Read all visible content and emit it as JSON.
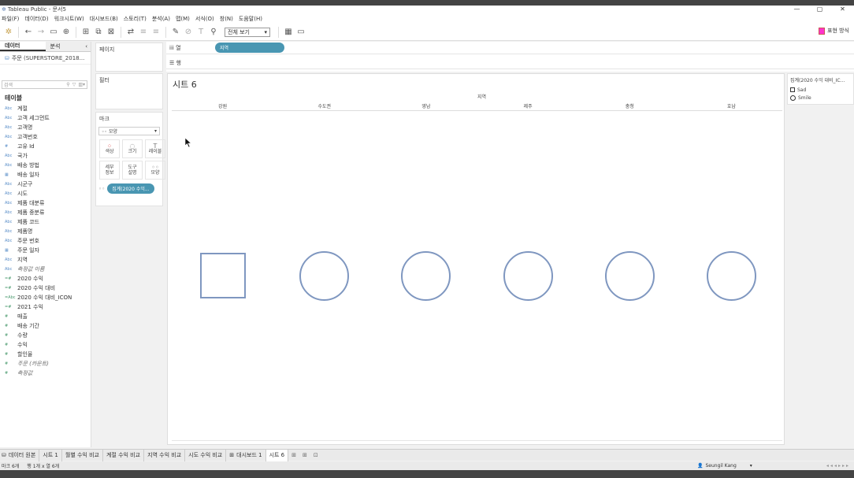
{
  "window": {
    "title": "Tableau Public - 문서5",
    "controls": [
      "—",
      "▢",
      "✕"
    ]
  },
  "menu": [
    "파일(F)",
    "데이터(D)",
    "워크시트(W)",
    "대시보드(B)",
    "스토리(T)",
    "분석(A)",
    "맵(M)",
    "서식(O)",
    "창(N)",
    "도움말(H)"
  ],
  "toolbar": {
    "view_select": "전체 보기",
    "show_me": "표현 방식"
  },
  "data_pane": {
    "tabs": [
      "데이터",
      "분석"
    ],
    "datasource": "주문 (SUPERSTORE_2018...",
    "search_placeholder": "검색",
    "table_header": "테이블",
    "fields": [
      {
        "type": "Abc",
        "name": "계절"
      },
      {
        "type": "Abc",
        "name": "고객 세그먼트"
      },
      {
        "type": "Abc",
        "name": "고객명"
      },
      {
        "type": "Abc",
        "name": "고객번호"
      },
      {
        "type": "#",
        "name": "고유 Id"
      },
      {
        "type": "Abc",
        "name": "국가"
      },
      {
        "type": "Abc",
        "name": "배송 방법"
      },
      {
        "type": "▦",
        "name": "배송 일자"
      },
      {
        "type": "Abc",
        "name": "시군구"
      },
      {
        "type": "Abc",
        "name": "시도"
      },
      {
        "type": "Abc",
        "name": "제품 대분류"
      },
      {
        "type": "Abc",
        "name": "제품 중분류"
      },
      {
        "type": "Abc",
        "name": "제품 코드"
      },
      {
        "type": "Abc",
        "name": "제품명"
      },
      {
        "type": "Abc",
        "name": "주문 번호"
      },
      {
        "type": "▦",
        "name": "주문 일자"
      },
      {
        "type": "Abc",
        "name": "지역"
      },
      {
        "type": "Abc",
        "name": "측정값 이름",
        "italic": true
      },
      {
        "type": "=#",
        "name": "2020 수익",
        "measure": true
      },
      {
        "type": "=#",
        "name": "2020 수익 대비",
        "measure": true
      },
      {
        "type": "=Abc",
        "name": "2020 수익 대비_ICON",
        "measure": true
      },
      {
        "type": "=#",
        "name": "2021 수익",
        "measure": true
      },
      {
        "type": "#",
        "name": "매출",
        "measure": true
      },
      {
        "type": "#",
        "name": "배송 기간",
        "measure": true
      },
      {
        "type": "#",
        "name": "수량",
        "measure": true
      },
      {
        "type": "#",
        "name": "수익",
        "measure": true
      },
      {
        "type": "#",
        "name": "할인율",
        "measure": true
      },
      {
        "type": "#",
        "name": "주문 (카운트)",
        "measure": true,
        "italic": true
      },
      {
        "type": "#",
        "name": "측정값",
        "measure": true,
        "italic": true
      }
    ]
  },
  "cards": {
    "pages": "페이지",
    "filters": "필터",
    "marks": "마크",
    "mark_type": "모양",
    "mark_buttons": [
      {
        "icon": "⁘",
        "label": "색상",
        "name": "color"
      },
      {
        "icon": "◌",
        "label": "크기",
        "name": "size"
      },
      {
        "icon": "T",
        "label": "레이블",
        "name": "label"
      },
      {
        "icon": "",
        "label": "세부\n정보",
        "name": "detail"
      },
      {
        "icon": "",
        "label": "도구\n설명",
        "name": "tooltip"
      },
      {
        "icon": "◦◦",
        "label": "모양",
        "name": "shape"
      }
    ],
    "marks_pill": "집계(2020 수익..."
  },
  "shelves": {
    "columns_label": "열",
    "columns_pill": "지역",
    "rows_label": "행"
  },
  "view": {
    "sheet_title": "시트 6",
    "column_header": "지역",
    "columns": [
      "강원",
      "수도권",
      "영남",
      "제주",
      "충청",
      "호남"
    ],
    "mark_shapes": [
      "square",
      "circle",
      "circle",
      "circle",
      "circle",
      "circle"
    ],
    "mark_color": "#7f97c0"
  },
  "legend": {
    "title": "집계(2020 수익 대비_IC...",
    "items": [
      {
        "shape": "square",
        "label": "Sad"
      },
      {
        "shape": "circle",
        "label": "Smile"
      }
    ]
  },
  "sheet_tabs": [
    "데이터 원본",
    "시트 1",
    "월별 수익 비교",
    "계절 수익 비교",
    "지역 수익 비교",
    "시도 수익 비교",
    "대시보드 1",
    "시트 6"
  ],
  "status": {
    "marks": "마크 6개",
    "dims": "행 1개 x 열 6개",
    "user": "Seungil Kang"
  }
}
